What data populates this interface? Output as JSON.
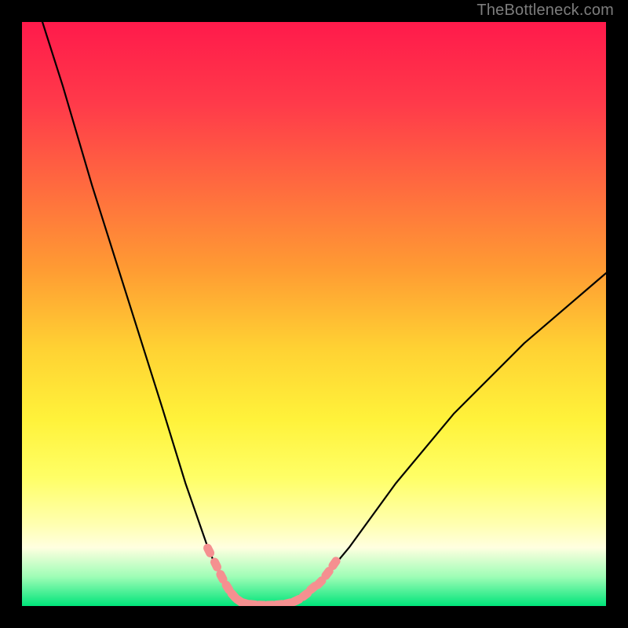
{
  "watermark": {
    "text": "TheBottleneck.com"
  },
  "colors": {
    "background": "#000000",
    "curve": "#000000",
    "marker_fill": "#f59090",
    "marker_stroke": "#d96a6a"
  },
  "chart_data": {
    "type": "line",
    "title": "",
    "xlabel": "",
    "ylabel": "",
    "xlim": [
      0,
      100
    ],
    "ylim": [
      0,
      100
    ],
    "grid": false,
    "legend": false,
    "series": [
      {
        "name": "curve-left",
        "x": [
          3.5,
          7,
          12,
          18,
          24,
          28,
          32,
          35,
          36.5,
          38
        ],
        "y": [
          100,
          89,
          72,
          53,
          34,
          21,
          9.5,
          3,
          1.2,
          0.5
        ]
      },
      {
        "name": "curve-bottom",
        "x": [
          38,
          40,
          42,
          44,
          46
        ],
        "y": [
          0.5,
          0.2,
          0.15,
          0.2,
          0.5
        ]
      },
      {
        "name": "curve-right",
        "x": [
          46,
          48,
          51,
          56,
          64,
          74,
          86,
          100
        ],
        "y": [
          0.5,
          1.5,
          4,
          10,
          21,
          33,
          45,
          57
        ]
      }
    ],
    "markers": [
      {
        "x": 32.0,
        "y": 9.5
      },
      {
        "x": 33.2,
        "y": 7.1
      },
      {
        "x": 34.2,
        "y": 5.0
      },
      {
        "x": 35.2,
        "y": 3.2
      },
      {
        "x": 36.2,
        "y": 1.8
      },
      {
        "x": 37.2,
        "y": 0.9
      },
      {
        "x": 38.2,
        "y": 0.45
      },
      {
        "x": 39.5,
        "y": 0.25
      },
      {
        "x": 41.0,
        "y": 0.15
      },
      {
        "x": 42.5,
        "y": 0.15
      },
      {
        "x": 44.0,
        "y": 0.25
      },
      {
        "x": 45.5,
        "y": 0.45
      },
      {
        "x": 47.0,
        "y": 0.95
      },
      {
        "x": 48.5,
        "y": 1.9
      },
      {
        "x": 49.8,
        "y": 3.1
      },
      {
        "x": 51.0,
        "y": 4.0
      },
      {
        "x": 52.3,
        "y": 5.6
      },
      {
        "x": 53.5,
        "y": 7.3
      }
    ]
  }
}
